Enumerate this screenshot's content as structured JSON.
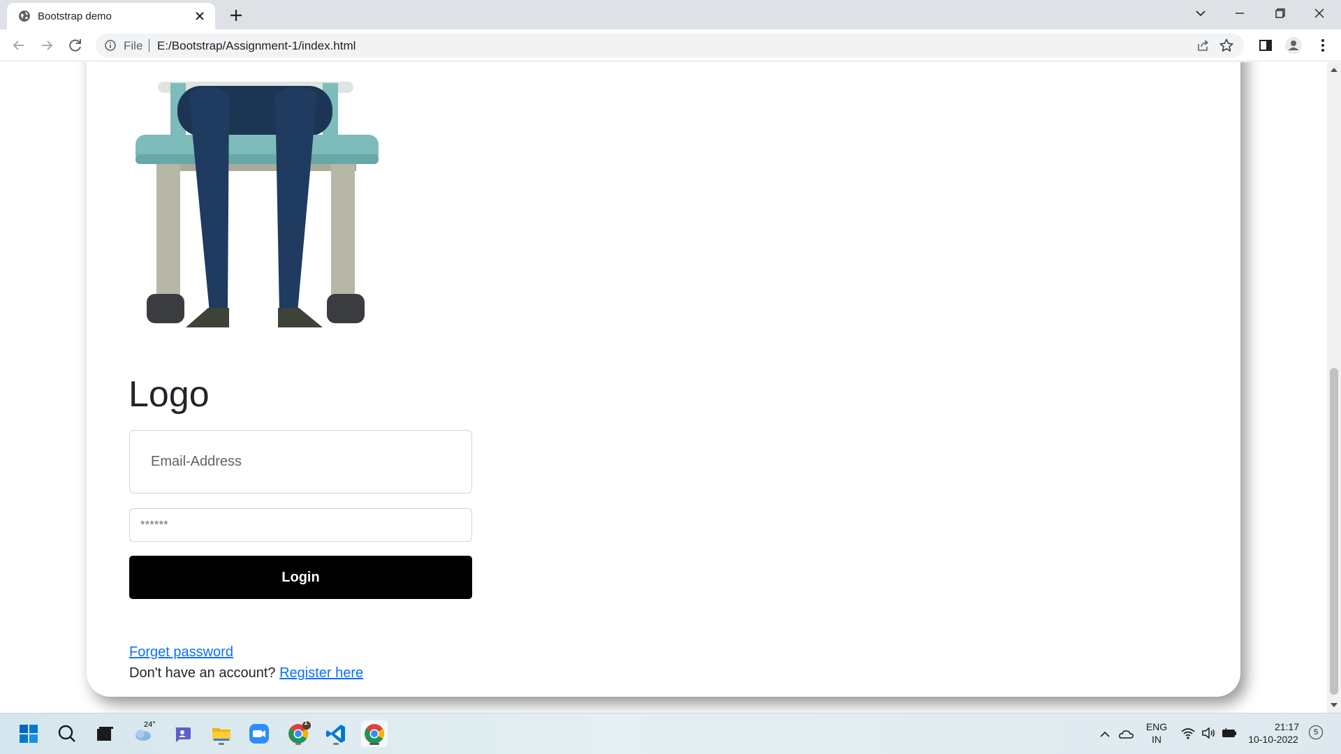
{
  "browser": {
    "tab_title": "Bootstrap demo",
    "scheme_label": "File",
    "url": "E:/Bootstrap/Assignment-1/index.html"
  },
  "page": {
    "logo_text": "Logo",
    "email_placeholder": "Email-Address",
    "password_placeholder": "******",
    "login_label": "Login",
    "forgot_label": "Forget password",
    "register_prompt": "Don't have an account?",
    "register_link": "Register here",
    "accent_color": "#0d6efd",
    "button_color": "#000000"
  },
  "taskbar": {
    "weather_temp": "24°",
    "chrome_badge": "1",
    "language": "ENG",
    "region": "IN",
    "time": "21:17",
    "date": "10-10-2022",
    "notification_count": "5",
    "apps": [
      "start-icon",
      "search-icon",
      "task-view-icon",
      "weather-icon",
      "teams-chat-icon",
      "file-explorer-icon",
      "zoom-icon",
      "chrome-icon",
      "vscode-icon",
      "chrome-icon"
    ]
  }
}
